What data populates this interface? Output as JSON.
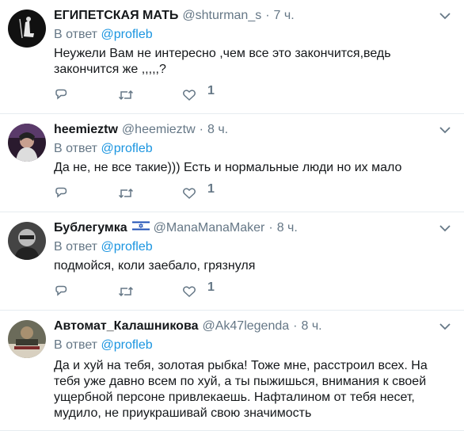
{
  "reply_prefix": "В ответ",
  "tweets": [
    {
      "name": "ЕГИПЕТСКАЯ МАТЬ",
      "handle": "@shturman_s",
      "time": "7 ч.",
      "reply_to": "@profleb",
      "text": "Неужели Вам не интересно ,чем все это закончится,ведь закончится же ,,,,,?",
      "likes": "1"
    },
    {
      "name": "heemieztw",
      "handle": "@heemieztw",
      "time": "8 ч.",
      "reply_to": "@profleb",
      "text": "Да не, не все такие))) Есть и нормальные люди но их мало",
      "likes": "1"
    },
    {
      "name": "Бублегумка",
      "handle": "@ManaManaMaker",
      "time": "8 ч.",
      "reply_to": "@profleb",
      "text": "подмойся, коли заебало, грязнуля",
      "likes": "1",
      "flag": "israel-flag-icon"
    },
    {
      "name": "Автомат_Калашникова",
      "handle": "@Ak47legenda",
      "time": "8 ч.",
      "reply_to": "@profleb",
      "text": "Да и хуй на тебя, золотая рыбка! Тоже мне, расстроил всех. На тебя уже давно всем по хуй, а ты пыжишься, внимания к своей ущербной персоне привлекаешь. Нафталином от тебя несет, мудило, не приукрашивай свою значимость"
    }
  ],
  "colors": {
    "link": "#1b95e0",
    "secondary": "#657786",
    "divider": "#e6ecf0"
  },
  "icons": [
    "reply-icon",
    "retweet-icon",
    "like-icon",
    "chevron-down-icon"
  ]
}
